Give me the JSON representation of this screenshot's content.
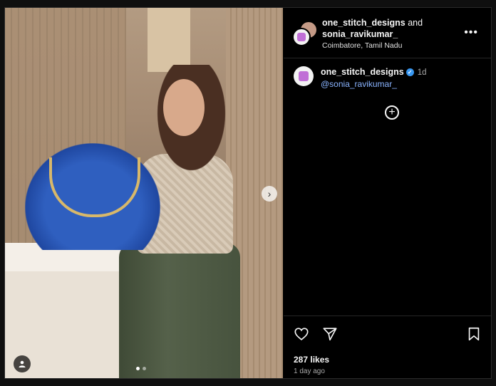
{
  "post": {
    "author": "one_stitch_designs",
    "and_text": "and",
    "collaborator": "sonia_ravikumar_",
    "location": "Coimbatore, Tamil Nadu",
    "more_icon": "more-horizontal-icon",
    "caption": {
      "username": "one_stitch_designs",
      "time": "1d",
      "mention": "@sonia_ravikumar_"
    },
    "likes": "287 likes",
    "posted_ago": "1 day ago",
    "carousel": {
      "total": 2,
      "active_index": 0
    }
  },
  "icons": {
    "like": "heart-icon",
    "share": "send-icon",
    "save": "bookmark-icon",
    "next": "chevron-right-icon",
    "tag": "user-tag-icon",
    "add": "plus-circle-icon"
  },
  "colors": {
    "background": "#000000",
    "mention": "#8ab4ff",
    "verified": "#3897f0"
  }
}
